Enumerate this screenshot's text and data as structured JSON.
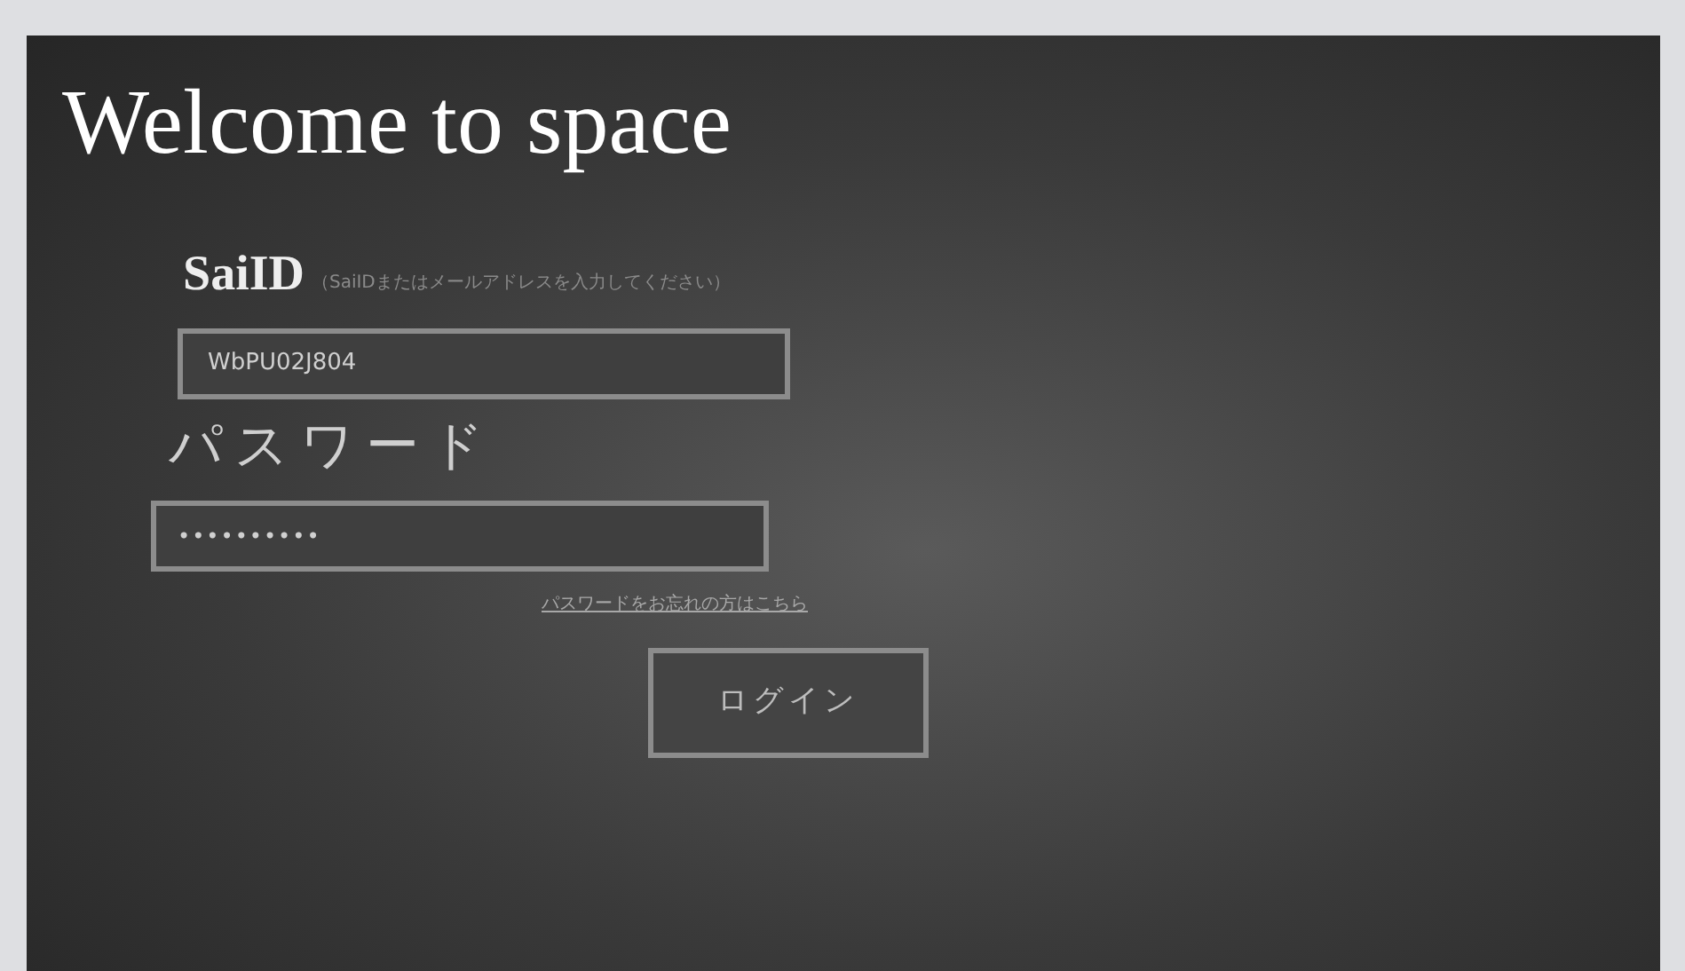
{
  "title": "Welcome to space",
  "id_field": {
    "label": "SaiID",
    "hint": "（SaiIDまたはメールアドレスを入力してください）",
    "value": "WbPU02J804"
  },
  "password_field": {
    "label": "パスワード",
    "value": "••••••••••"
  },
  "forgot_link": "パスワードをお忘れの方はこちら",
  "login_button": "ログイン"
}
